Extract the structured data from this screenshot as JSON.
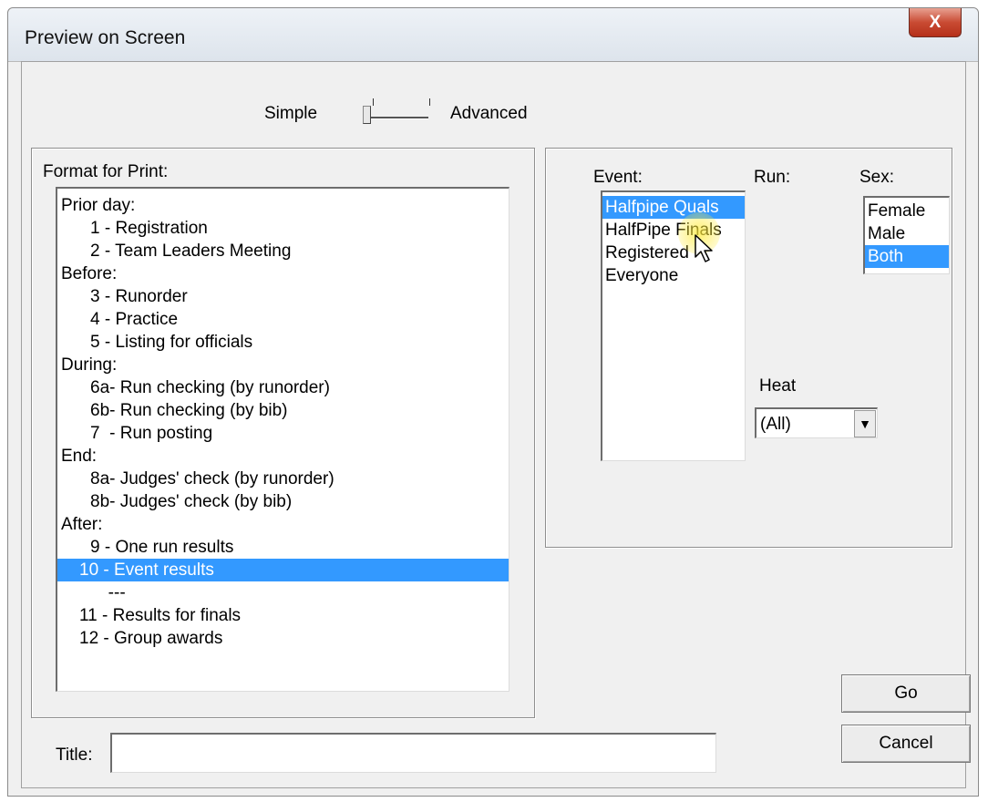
{
  "window": {
    "title": "Preview on Screen",
    "close_glyph": "X"
  },
  "mode_slider": {
    "left_label": "Simple",
    "right_label": "Advanced"
  },
  "format_group": {
    "label": "Format for Print:",
    "items": [
      {
        "text": "Prior day:",
        "level": 0,
        "selected": false
      },
      {
        "text": "1 - Registration",
        "level": 1,
        "selected": false
      },
      {
        "text": "2 - Team Leaders Meeting",
        "level": 1,
        "selected": false
      },
      {
        "text": "Before:",
        "level": 0,
        "selected": false
      },
      {
        "text": "3 - Runorder",
        "level": 1,
        "selected": false
      },
      {
        "text": "4 - Practice",
        "level": 1,
        "selected": false
      },
      {
        "text": "5 - Listing for officials",
        "level": 1,
        "selected": false
      },
      {
        "text": "During:",
        "level": 0,
        "selected": false
      },
      {
        "text": "6a- Run checking (by runorder)",
        "level": 1,
        "selected": false
      },
      {
        "text": "6b- Run checking (by bib)",
        "level": 1,
        "selected": false
      },
      {
        "text": "7  - Run posting",
        "level": 1,
        "selected": false
      },
      {
        "text": "End:",
        "level": 0,
        "selected": false
      },
      {
        "text": "8a- Judges' check (by runorder)",
        "level": 1,
        "selected": false
      },
      {
        "text": "8b- Judges' check (by bib)",
        "level": 1,
        "selected": false
      },
      {
        "text": "After:",
        "level": 0,
        "selected": false
      },
      {
        "text": "9 - One run results",
        "level": 1,
        "selected": false
      },
      {
        "text": "10 - Event results",
        "level": 2,
        "selected": true
      },
      {
        "text": "      ---",
        "level": 2,
        "selected": false
      },
      {
        "text": "11 - Results for finals",
        "level": 2,
        "selected": false
      },
      {
        "text": "12 - Group awards",
        "level": 2,
        "selected": false
      }
    ]
  },
  "event": {
    "label": "Event:",
    "items": [
      {
        "text": "Halfpipe Quals",
        "selected": true
      },
      {
        "text": "HalfPipe Finals",
        "selected": false
      },
      {
        "text": "Registered",
        "selected": false
      },
      {
        "text": "Everyone",
        "selected": false
      }
    ]
  },
  "run": {
    "label": "Run:"
  },
  "sex": {
    "label": "Sex:",
    "items": [
      {
        "text": "Female",
        "selected": false
      },
      {
        "text": "Male",
        "selected": false
      },
      {
        "text": "Both",
        "selected": true
      }
    ]
  },
  "heat": {
    "label": "Heat",
    "value": "(All)",
    "arrow_icon": "▼"
  },
  "buttons": {
    "go": "Go",
    "cancel": "Cancel"
  },
  "title_field": {
    "label": "Title:",
    "value": ""
  },
  "colors": {
    "selection": "#3399ff",
    "cursor_highlight": "#ffeb3c"
  }
}
